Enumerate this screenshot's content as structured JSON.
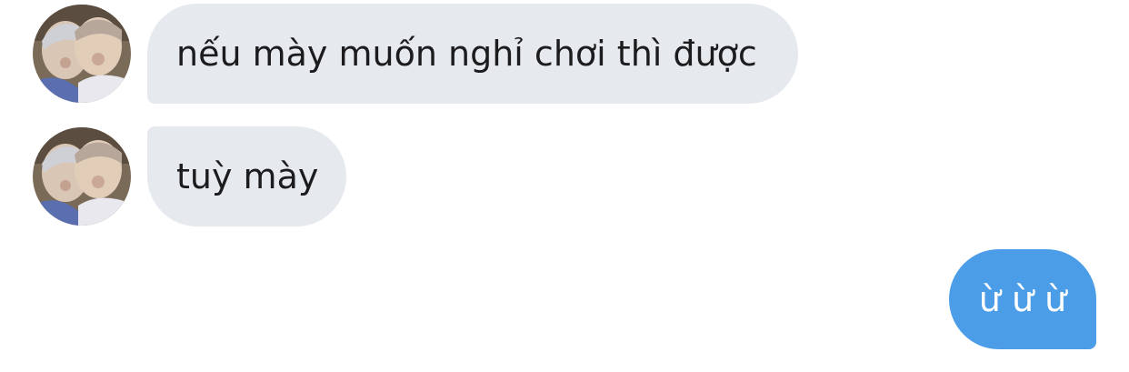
{
  "conversation": {
    "messages": [
      {
        "direction": "incoming",
        "text": "nếu mày muốn nghỉ chơi thì được",
        "avatar": "friend-avatar"
      },
      {
        "direction": "incoming",
        "text": "tuỳ mày",
        "avatar": "friend-avatar"
      },
      {
        "direction": "outgoing",
        "text": "ừ ừ ừ"
      }
    ]
  },
  "colors": {
    "incoming_bubble": "#e6e9ed",
    "outgoing_bubble": "#4c9de8",
    "incoming_text": "#1c1c1e",
    "outgoing_text": "#ffffff"
  }
}
